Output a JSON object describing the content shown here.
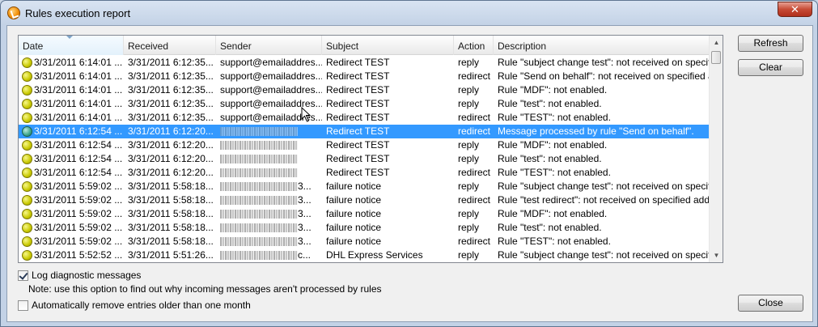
{
  "window": {
    "title": "Rules execution report",
    "close_label": "✕"
  },
  "columns": [
    "Date",
    "Received",
    "Sender",
    "Subject",
    "Action",
    "Description"
  ],
  "rows": [
    {
      "date": "3/31/2011 6:14:01 ...",
      "received": "3/31/2011 6:12:35...",
      "sender": "support@emailaddres...",
      "subject": "Redirect TEST",
      "action": "reply",
      "description": "Rule \"subject change test\": not received on specifie...",
      "selected": false
    },
    {
      "date": "3/31/2011 6:14:01 ...",
      "received": "3/31/2011 6:12:35...",
      "sender": "support@emailaddres...",
      "subject": "Redirect TEST",
      "action": "redirect",
      "description": "Rule \"Send on behalf\": not received on specified ad...",
      "selected": false
    },
    {
      "date": "3/31/2011 6:14:01 ...",
      "received": "3/31/2011 6:12:35...",
      "sender": "support@emailaddres...",
      "subject": "Redirect TEST",
      "action": "reply",
      "description": "Rule \"MDF\": not enabled.",
      "selected": false
    },
    {
      "date": "3/31/2011 6:14:01 ...",
      "received": "3/31/2011 6:12:35...",
      "sender": "support@emailaddres...",
      "subject": "Redirect TEST",
      "action": "reply",
      "description": "Rule \"test\": not enabled.",
      "selected": false
    },
    {
      "date": "3/31/2011 6:14:01 ...",
      "received": "3/31/2011 6:12:35...",
      "sender": "support@emailaddres...",
      "subject": "Redirect TEST",
      "action": "redirect",
      "description": "Rule \"TEST\": not enabled.",
      "selected": false
    },
    {
      "date": "3/31/2011 6:12:54 ...",
      "received": "3/31/2011 6:12:20...",
      "sender": "",
      "subject": "Redirect TEST",
      "action": "redirect",
      "description": "Message processed by rule \"Send on behalf\".",
      "selected": true
    },
    {
      "date": "3/31/2011 6:12:54 ...",
      "received": "3/31/2011 6:12:20...",
      "sender": "",
      "subject": "Redirect TEST",
      "action": "reply",
      "description": "Rule \"MDF\": not enabled.",
      "selected": false
    },
    {
      "date": "3/31/2011 6:12:54 ...",
      "received": "3/31/2011 6:12:20...",
      "sender": "",
      "subject": "Redirect TEST",
      "action": "reply",
      "description": "Rule \"test\": not enabled.",
      "selected": false
    },
    {
      "date": "3/31/2011 6:12:54 ...",
      "received": "3/31/2011 6:12:20...",
      "sender": "",
      "subject": "Redirect TEST",
      "action": "redirect",
      "description": "Rule \"TEST\": not enabled.",
      "selected": false
    },
    {
      "date": "3/31/2011 5:59:02 ...",
      "received": "3/31/2011 5:58:18...",
      "sender": "3...",
      "subject": "failure notice",
      "action": "reply",
      "description": "Rule \"subject change test\": not received on specifie...",
      "selected": false
    },
    {
      "date": "3/31/2011 5:59:02 ...",
      "received": "3/31/2011 5:58:18...",
      "sender": "3...",
      "subject": "failure notice",
      "action": "redirect",
      "description": "Rule \"test redirect\": not received on specified addr...",
      "selected": false
    },
    {
      "date": "3/31/2011 5:59:02 ...",
      "received": "3/31/2011 5:58:18...",
      "sender": "3...",
      "subject": "failure notice",
      "action": "reply",
      "description": "Rule \"MDF\": not enabled.",
      "selected": false
    },
    {
      "date": "3/31/2011 5:59:02 ...",
      "received": "3/31/2011 5:58:18...",
      "sender": "3...",
      "subject": "failure notice",
      "action": "reply",
      "description": "Rule \"test\": not enabled.",
      "selected": false
    },
    {
      "date": "3/31/2011 5:59:02 ...",
      "received": "3/31/2011 5:58:18...",
      "sender": "3...",
      "subject": "failure notice",
      "action": "redirect",
      "description": "Rule \"TEST\": not enabled.",
      "selected": false
    },
    {
      "date": "3/31/2011 5:52:52 ...",
      "received": "3/31/2011 5:51:26...",
      "sender": "c...",
      "subject": "DHL Express Services",
      "action": "reply",
      "description": "Rule \"subject change test\": not received on specifie...",
      "selected": false
    }
  ],
  "buttons": {
    "refresh": "Refresh",
    "clear": "Clear",
    "close": "Close"
  },
  "options": {
    "log_diagnostic": {
      "label": "Log diagnostic messages",
      "checked": true
    },
    "note": "Note: use this option to find out why incoming messages aren't processed by rules",
    "auto_remove": {
      "label": "Automatically remove entries older than one month",
      "checked": false
    }
  },
  "icons": {
    "status_pending": "yellow-status-icon",
    "status_processed": "green-status-icon",
    "app": "app-icon"
  },
  "colors": {
    "selection": "#3399ff",
    "status_yellow": "#c9c900",
    "status_green": "#3da48a"
  }
}
